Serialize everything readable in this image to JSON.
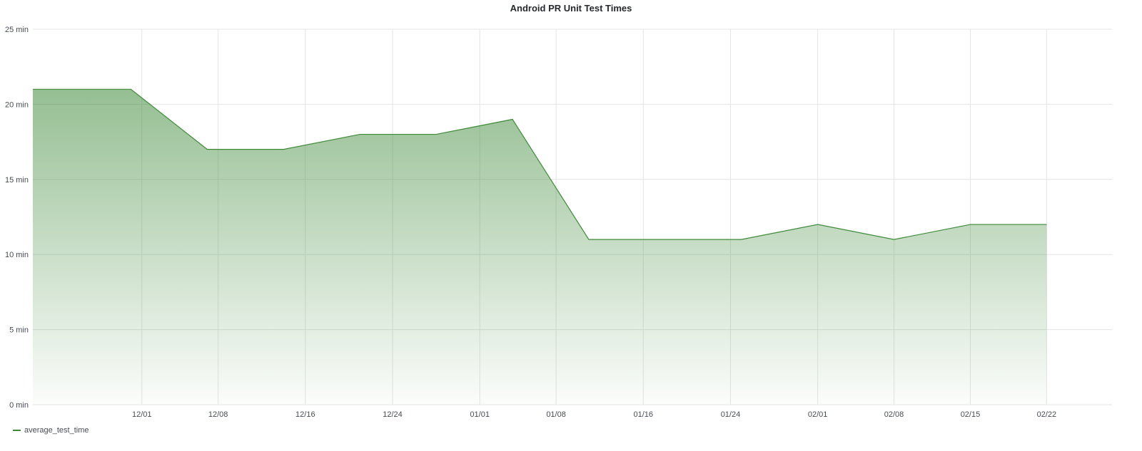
{
  "chart_data": {
    "type": "area",
    "title": "Android PR Unit Test Times",
    "xlabel": "",
    "ylabel": "",
    "ylim": [
      0,
      25
    ],
    "y_ticks": [
      {
        "value": 0,
        "label": "0 min"
      },
      {
        "value": 5,
        "label": "5 min"
      },
      {
        "value": 10,
        "label": "10 min"
      },
      {
        "value": 15,
        "label": "15 min"
      },
      {
        "value": 20,
        "label": "20 min"
      },
      {
        "value": 25,
        "label": "25 min"
      }
    ],
    "xlim": [
      "11/21",
      "02/28"
    ],
    "x_ticks": [
      "12/01",
      "12/08",
      "12/16",
      "12/24",
      "01/01",
      "01/08",
      "01/16",
      "01/24",
      "02/01",
      "02/08",
      "02/15",
      "02/22"
    ],
    "grid": true,
    "legend_position": "bottom-left",
    "series": [
      {
        "name": "average_test_time",
        "color": "#3f8a3a",
        "x": [
          "11/21",
          "11/30",
          "12/07",
          "12/14",
          "12/21",
          "12/28",
          "01/04",
          "01/11",
          "01/18",
          "01/25",
          "02/01",
          "02/08",
          "02/15",
          "02/22"
        ],
        "values": [
          21,
          21,
          17,
          17,
          18,
          18,
          19,
          11,
          11,
          11,
          12,
          11,
          12,
          12
        ]
      }
    ]
  }
}
